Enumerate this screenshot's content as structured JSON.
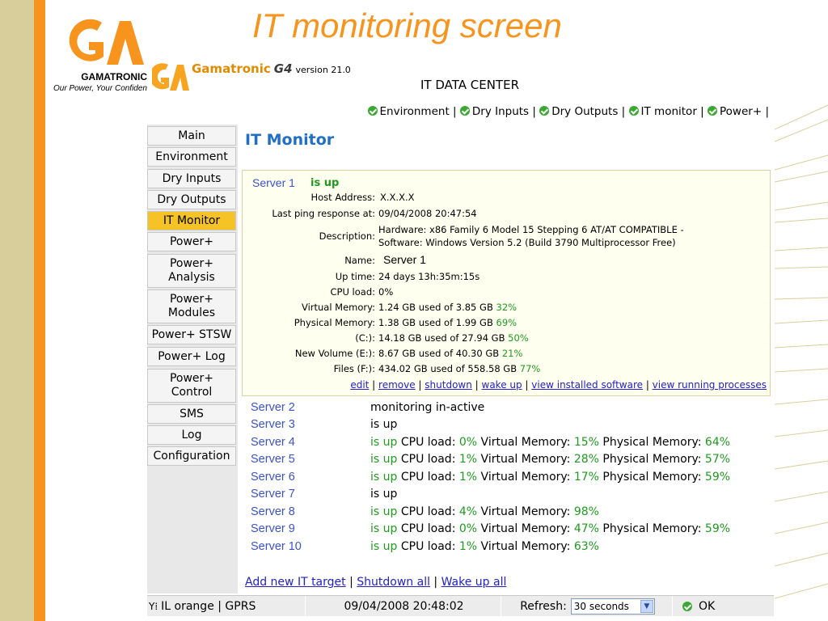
{
  "slide": {
    "title": "IT monitoring screen",
    "brand_name": "GAMATRONIC",
    "brand_tagline": "Our Power, Your Confidence",
    "accent": "#f7941d"
  },
  "header": {
    "app_name": "Gamatronic",
    "app_suffix": "G4",
    "version": "version 21.0",
    "dc_title": "IT DATA CENTER"
  },
  "top_nav": [
    {
      "label": "Environment"
    },
    {
      "label": "Dry Inputs"
    },
    {
      "label": "Dry Outputs"
    },
    {
      "label": "IT monitor"
    },
    {
      "label": "Power+"
    }
  ],
  "sidebar": {
    "items": [
      {
        "label": "Main"
      },
      {
        "label": "Environment"
      },
      {
        "label": "Dry Inputs"
      },
      {
        "label": "Dry Outputs"
      },
      {
        "label": "IT Monitor"
      },
      {
        "label": "Power+"
      },
      {
        "label": "Power+ Analysis"
      },
      {
        "label": "Power+ Modules"
      },
      {
        "label": "Power+ STSW"
      },
      {
        "label": "Power+ Log"
      },
      {
        "label": "Power+ Control"
      },
      {
        "label": "SMS"
      },
      {
        "label": "Log"
      },
      {
        "label": "Configuration"
      }
    ],
    "active": "IT Monitor"
  },
  "main": {
    "title": "IT Monitor",
    "server1": {
      "name": "Server 1",
      "status": "is up",
      "host_label": "Host Address:",
      "host_value": "X.X.X.X",
      "ping_label": "Last ping response at:",
      "ping_value": "09/04/2008 20:47:54",
      "desc_label": "Description:",
      "desc_line1": "Hardware: x86 Family 6 Model 15 Stepping 6 AT/AT COMPATIBLE -",
      "desc_line2": "Software: Windows Version 5.2 (Build 3790 Multiprocessor Free)",
      "name_label": "Name:",
      "name_value": "Server 1",
      "uptime_label": "Up time:",
      "uptime_value": "24 days 13h:35m:15s",
      "cpu_label": "CPU load:",
      "cpu_value": "0%",
      "vmem_label": "Virtual Memory:",
      "vmem_value": "1.24 GB used of 3.85 GB",
      "vmem_pct": "32%",
      "pmem_label": "Physical Memory:",
      "pmem_value": "1.38 GB used of 1.99 GB",
      "pmem_pct": "69%",
      "c_label": "(C:):",
      "c_value": "14.18 GB used of 27.94 GB",
      "c_pct": "50%",
      "e_label": "New Volume (E:):",
      "e_value": "8.67 GB used of 40.30 GB",
      "e_pct": "21%",
      "f_label": "Files (F:):",
      "f_value": "434.02 GB used of 558.58 GB",
      "f_pct": "77%",
      "actions": {
        "edit": "edit",
        "remove": "remove",
        "shutdown": "shutdown",
        "wakeup": "wake up",
        "software": "view installed software",
        "processes": "view running processes"
      }
    },
    "servers": [
      {
        "name": "Server 2",
        "status": "monitoring in-active"
      },
      {
        "name": "Server 3",
        "status": "is up"
      },
      {
        "name": "Server 4",
        "status": "is up",
        "cpu": "0%",
        "vm": "15%",
        "pm": "64%"
      },
      {
        "name": "Server 5",
        "status": "is up",
        "cpu": "1%",
        "vm": "28%",
        "pm": "57%"
      },
      {
        "name": "Server 6",
        "status": "is up",
        "cpu": "1%",
        "vm": "17%",
        "pm": "59%"
      },
      {
        "name": "Server 7",
        "status": "is up"
      },
      {
        "name": "Server 8",
        "status": "is up",
        "cpu": "4%",
        "vm": "98%"
      },
      {
        "name": "Server 9",
        "status": "is up",
        "cpu": "0%",
        "vm": "47%",
        "pm": "59%"
      },
      {
        "name": "Server 10",
        "status": "is up",
        "cpu": "1%",
        "vm": "63%"
      }
    ],
    "metric_labels": {
      "cpu": "CPU load:",
      "vm": "Virtual Memory:",
      "pm": "Physical Memory:"
    },
    "bottom_links": {
      "add": "Add new IT target",
      "shutdown_all": "Shutdown all",
      "wake_all": "Wake up all"
    }
  },
  "status_bar": {
    "network": "IL orange | GPRS",
    "datetime": "09/04/2008 20:48:02",
    "refresh_label": "Refresh:",
    "refresh_value": "30 seconds",
    "ok": "OK"
  },
  "colors": {
    "title_blue": "#1f6fc4",
    "server_blue": "#3b53c9",
    "status_green": "#1f9a1f",
    "active_nav": "#f5c325"
  },
  "icons": {
    "check": "check-circle-icon",
    "antenna": "antenna-icon",
    "dropdown": "chevron-down-icon"
  }
}
